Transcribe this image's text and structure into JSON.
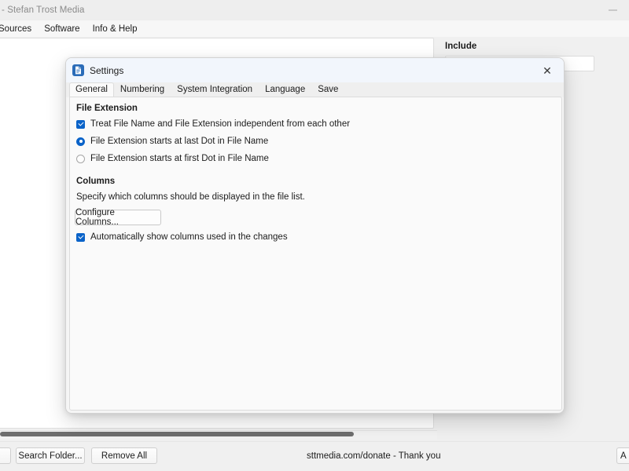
{
  "app": {
    "title": "- Stefan Trost Media",
    "minimize_icon": "minimize-icon",
    "menu": [
      {
        "label": "Sources"
      },
      {
        "label": "Software"
      },
      {
        "label": "Info & Help"
      }
    ],
    "right_pane": {
      "include_label": "Include"
    },
    "bottom_bar": {
      "search_folder_label": "Search Folder...",
      "remove_all_label": "Remove All",
      "donate_text": "sttmedia.com/donate - Thank you",
      "cut_right_label": "A"
    }
  },
  "dialog": {
    "title": "Settings",
    "app_icon": "document-icon",
    "close_icon": "close-icon",
    "tabs": [
      {
        "label": "General",
        "active": true
      },
      {
        "label": "Numbering",
        "active": false
      },
      {
        "label": "System Integration",
        "active": false
      },
      {
        "label": "Language",
        "active": false
      },
      {
        "label": "Save",
        "active": false
      }
    ],
    "file_extension": {
      "group_title": "File Extension",
      "checkbox_independent": {
        "label": "Treat File Name and File Extension independent from each other",
        "checked": true
      },
      "radio_last_dot": {
        "label": "File Extension starts at last Dot in File Name",
        "selected": true
      },
      "radio_first_dot": {
        "label": "File Extension starts at first Dot in File Name",
        "selected": false
      }
    },
    "columns": {
      "group_title": "Columns",
      "description": "Specify which columns should be displayed in the file list.",
      "configure_button_label": "Configure Columns...",
      "auto_show_checkbox": {
        "label": "Automatically show columns used in the changes",
        "checked": true
      }
    }
  },
  "colors": {
    "accent": "#0a63c9",
    "dialog_titlebar": "#f2f6fc",
    "dialog_body": "#fafafa",
    "window_bg": "#f0f0f0"
  }
}
